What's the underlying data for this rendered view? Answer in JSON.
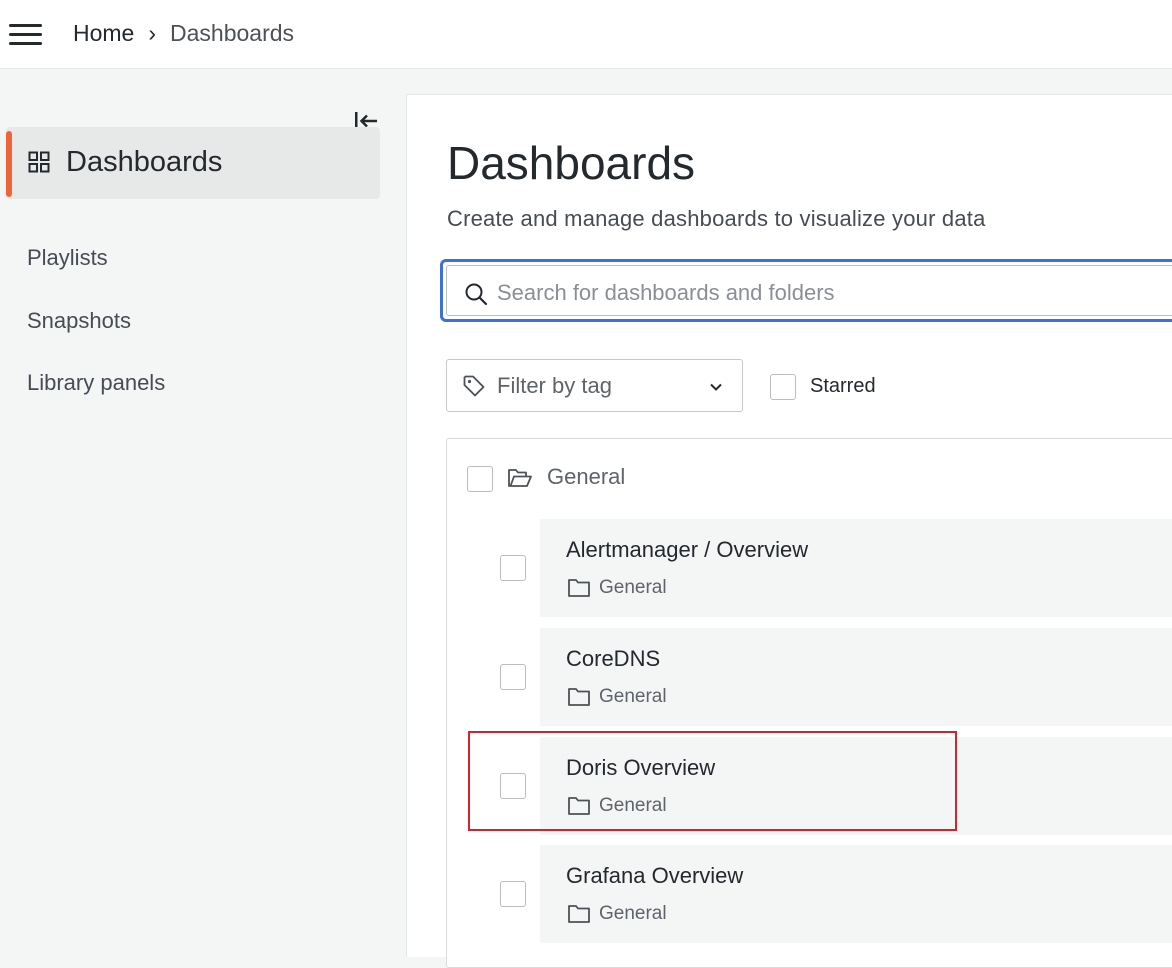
{
  "breadcrumb": {
    "home": "Home",
    "separator": "›",
    "current": "Dashboards"
  },
  "sidebar": {
    "active_item": "Dashboards",
    "items": [
      {
        "label": "Playlists"
      },
      {
        "label": "Snapshots"
      },
      {
        "label": "Library panels"
      }
    ]
  },
  "main": {
    "title": "Dashboards",
    "subtitle": "Create and manage dashboards to visualize your data",
    "search": {
      "placeholder": "Search for dashboards and folders",
      "value": ""
    },
    "tag_filter": {
      "label": "Filter by tag"
    },
    "starred": {
      "label": "Starred",
      "checked": false
    }
  },
  "folder": {
    "name": "General",
    "dashboards": [
      {
        "title": "Alertmanager / Overview",
        "folder": "General"
      },
      {
        "title": "CoreDNS",
        "folder": "General"
      },
      {
        "title": "Doris Overview",
        "folder": "General",
        "highlighted": true
      },
      {
        "title": "Grafana Overview",
        "folder": "General"
      }
    ]
  },
  "colors": {
    "accent_active": "#f0643a",
    "search_focus": "#3d71d9",
    "highlight_box": "#d9212a"
  },
  "icons": {
    "menu": "hamburger-icon",
    "collapse": "dock-left-icon",
    "dashboards": "grid-icon",
    "search": "search-icon",
    "tag": "tag-icon",
    "dropdown": "chevron-down-icon",
    "folder_open": "folder-open-icon",
    "folder": "folder-icon"
  }
}
